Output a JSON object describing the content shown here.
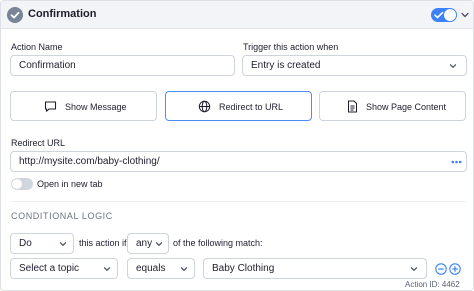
{
  "header": {
    "title": "Confirmation",
    "toggle_on": true
  },
  "form": {
    "action_name_label": "Action Name",
    "action_name_value": "Confirmation",
    "trigger_label": "Trigger this action when",
    "trigger_value": "Entry is created",
    "types": [
      {
        "label": "Show Message",
        "icon": "chat-bubble-icon",
        "active": false
      },
      {
        "label": "Redirect to URL",
        "icon": "globe-icon",
        "active": true
      },
      {
        "label": "Show Page Content",
        "icon": "document-icon",
        "active": false
      }
    ],
    "redirect_label": "Redirect URL",
    "redirect_value": "http://mysite.com/baby-clothing/",
    "new_tab_label": "Open in new tab",
    "new_tab_on": false
  },
  "conditional": {
    "section_title": "CONDITIONAL LOGIC",
    "do_value": "Do",
    "this_action_if": "this action if",
    "any_value": "any",
    "following_text": "of the following match:",
    "topic_value": "Select a topic",
    "operator_value": "equals",
    "match_value": "Baby Clothing"
  },
  "footer": {
    "action_id": "Action ID: 4462"
  },
  "colors": {
    "accent": "#3b82f6",
    "border": "#cfd3da",
    "header_bg": "#f3f4f7"
  }
}
